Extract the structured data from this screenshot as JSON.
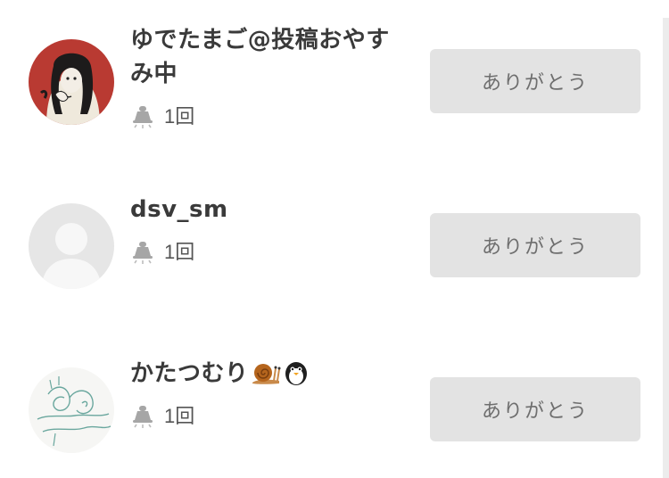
{
  "users": [
    {
      "name": "ゆでたまご@投稿おやすみ中",
      "emoji": [],
      "count": "1回",
      "button_label": "ありがとう",
      "avatar": "illustrated-portrait"
    },
    {
      "name": "dsv_sm",
      "emoji": [],
      "count": "1回",
      "button_label": "ありがとう",
      "avatar": "default-silhouette"
    },
    {
      "name": "かたつむり",
      "emoji": [
        "snail-emoji",
        "penguin-emoji"
      ],
      "count": "1回",
      "button_label": "ありがとう",
      "avatar": "line-sketch"
    }
  ],
  "icons": {
    "reaction": "clap-icon"
  },
  "colors": {
    "button_bg": "#e3e3e3",
    "button_text": "#6e6e6e",
    "name_text": "#3a3a3a",
    "avatar_placeholder": "#e6e6e6",
    "sketch_line": "#6aa79e"
  }
}
